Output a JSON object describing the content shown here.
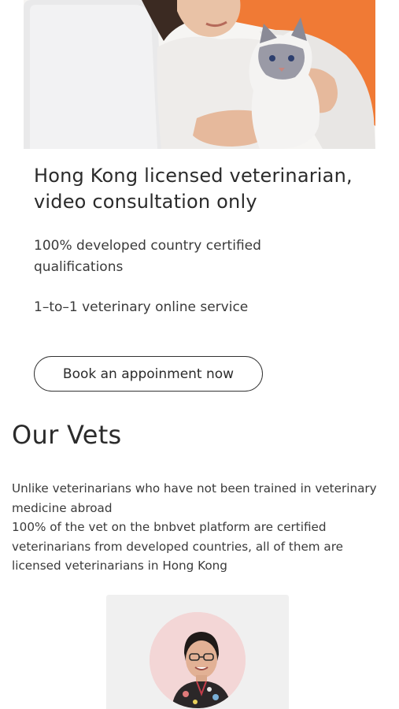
{
  "hero": {
    "image_icon": "woman-holding-cat-photo",
    "headline": "Hong Kong licensed veterinarian, video consultation only",
    "features": [
      "100% developed country certified qualifications",
      "1–to–1 veterinary online service"
    ],
    "cta_label": "Book an appoinment now"
  },
  "vets_section": {
    "title": "Our Vets",
    "paragraphs": [
      "Unlike veterinarians who have not been trained in veterinary medicine abroad",
      "100% of the vet on the bnbvet platform are certified veterinarians from developed countries, all of them are licensed veterinarians in Hong Kong"
    ]
  },
  "vet_card": {
    "avatar_icon": "vet-portrait-photo"
  },
  "colors": {
    "accent_orange": "#f07a35",
    "text": "#333333",
    "card_bg": "#f0f0f0",
    "avatar_bg": "#f3d6d6"
  }
}
